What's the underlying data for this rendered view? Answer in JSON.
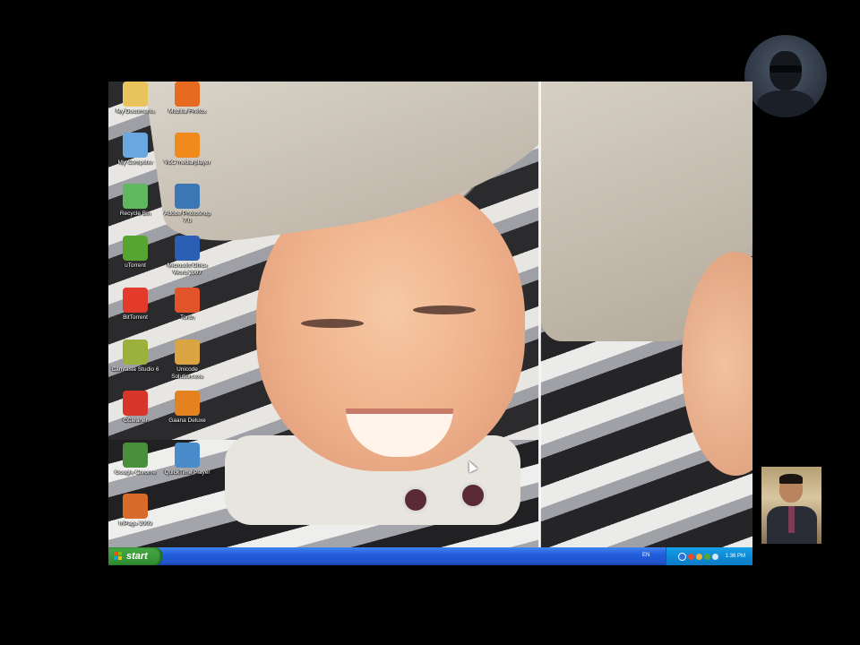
{
  "desktop": {
    "icons": [
      {
        "label": "My Documents",
        "icon": "my-documents-icon",
        "color": "#e9c35b"
      },
      {
        "label": "Mozilla Firefox",
        "icon": "firefox-icon",
        "color": "#e66a1f"
      },
      {
        "label": "My Computer",
        "icon": "my-computer-icon",
        "color": "#6aa6e0"
      },
      {
        "label": "VLC media player",
        "icon": "vlc-icon",
        "color": "#f08a1c"
      },
      {
        "label": "Recycle Bin",
        "icon": "recycle-bin-icon",
        "color": "#5fb85f"
      },
      {
        "label": "Adobe Photoshop 7.0",
        "icon": "photoshop-icon",
        "color": "#3b77b5"
      },
      {
        "label": "uTorrent",
        "icon": "utorrent-icon",
        "color": "#56a531"
      },
      {
        "label": "Microsoft Office Word 2007",
        "icon": "word-icon",
        "color": "#2b5fb3"
      },
      {
        "label": "BitTorrent",
        "icon": "bittorrent-icon",
        "color": "#e23b2b"
      },
      {
        "label": "Torch",
        "icon": "torch-icon",
        "color": "#e2532a"
      },
      {
        "label": "Camtasia Studio 6",
        "icon": "camtasia-icon",
        "color": "#9bb13b"
      },
      {
        "label": "Unicode Solution.exe",
        "icon": "unicode-solution-icon",
        "color": "#d9a441"
      },
      {
        "label": "CCleaner",
        "icon": "ccleaner-icon",
        "color": "#d8362a"
      },
      {
        "label": "Gaana Deluxe",
        "icon": "gaana-icon",
        "color": "#e3821f"
      },
      {
        "label": "Google Chrome",
        "icon": "chrome-icon",
        "color": "#4a8f3c"
      },
      {
        "label": "QuickTime Player",
        "icon": "quicktime-icon",
        "color": "#4a8ccb"
      },
      {
        "label": "InPage 2009",
        "icon": "inpage-icon",
        "color": "#d86a2a"
      }
    ]
  },
  "taskbar": {
    "start_label": "start",
    "language": "EN",
    "clock": "1:36 PM"
  },
  "colors": {
    "taskbar": "#245edb",
    "start_button": "#3b9b3b",
    "tray": "#0f8ad6"
  }
}
